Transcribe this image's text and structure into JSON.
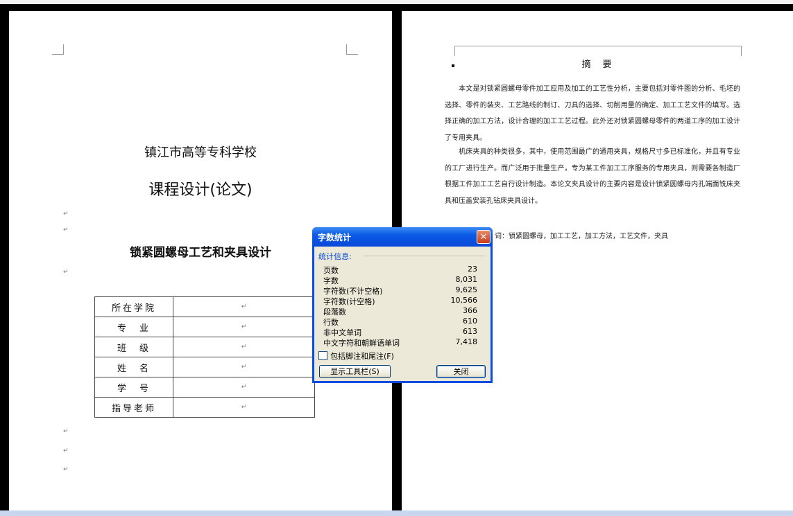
{
  "left_page": {
    "school": "镇江市高等专科学校",
    "doc_type": "课程设计(论文)",
    "thesis_title": "锁紧圆螺母工艺和夹具设计",
    "info_table": [
      {
        "label": "所在学院",
        "value": ""
      },
      {
        "label": "专　业",
        "value": ""
      },
      {
        "label": "班　级",
        "value": ""
      },
      {
        "label": "姓　名",
        "value": ""
      },
      {
        "label": "学　号",
        "value": ""
      },
      {
        "label": "指导老师",
        "value": ""
      }
    ],
    "para_mark": "↵"
  },
  "right_page": {
    "heading": "摘　要",
    "paragraphs": [
      "本文是对锁紧圆螺母零件加工应用及加工的工艺性分析，主要包括对零件图的分析、毛坯的选择、零件的装夹、工艺路线的制订、刀具的选择、切削用量的确定、加工工艺文件的填写。选择正确的加工方法，设计合理的加工工艺过程。此外还对锁紧圆螺母零件的两道工序的加工设计了专用夹具。",
      "机床夹具的种类很多，其中，使用范围最广的通用夹具，规格尺寸多已标准化，并且有专业的工厂进行生产。而广泛用于批量生产，专为某工件加工工序服务的专用夹具，则需要各制造厂根据工件加工工艺自行设计制造。本论文夹具设计的主要内容是设计锁紧圆螺母内孔端面铣床夹具和压盖安装孔钻床夹具设计。"
    ],
    "keywords_visible": "词：锁紧圆螺母，加工工艺，加工方法，工艺文件，夹具"
  },
  "dialog": {
    "title": "字数统计",
    "close_glyph": "✕",
    "group_label": "统计信息:",
    "stats": [
      {
        "label": "页数",
        "value": "23"
      },
      {
        "label": "字数",
        "value": "8,031"
      },
      {
        "label": "字符数(不计空格)",
        "value": "9,625"
      },
      {
        "label": "字符数(计空格)",
        "value": "10,566"
      },
      {
        "label": "段落数",
        "value": "366"
      },
      {
        "label": "行数",
        "value": "610"
      },
      {
        "label": "非中文单词",
        "value": "613"
      },
      {
        "label": "中文字符和朝鲜语单词",
        "value": "7,418"
      }
    ],
    "include_footnotes_label": "包括脚注和尾注(F)",
    "show_toolbar_button": "显示工具栏(S)",
    "close_button": "关闭"
  },
  "colors": {
    "title_bar": "#0a5ae6",
    "dialog_face": "#ece9d8",
    "close_x": "#d9502d"
  }
}
